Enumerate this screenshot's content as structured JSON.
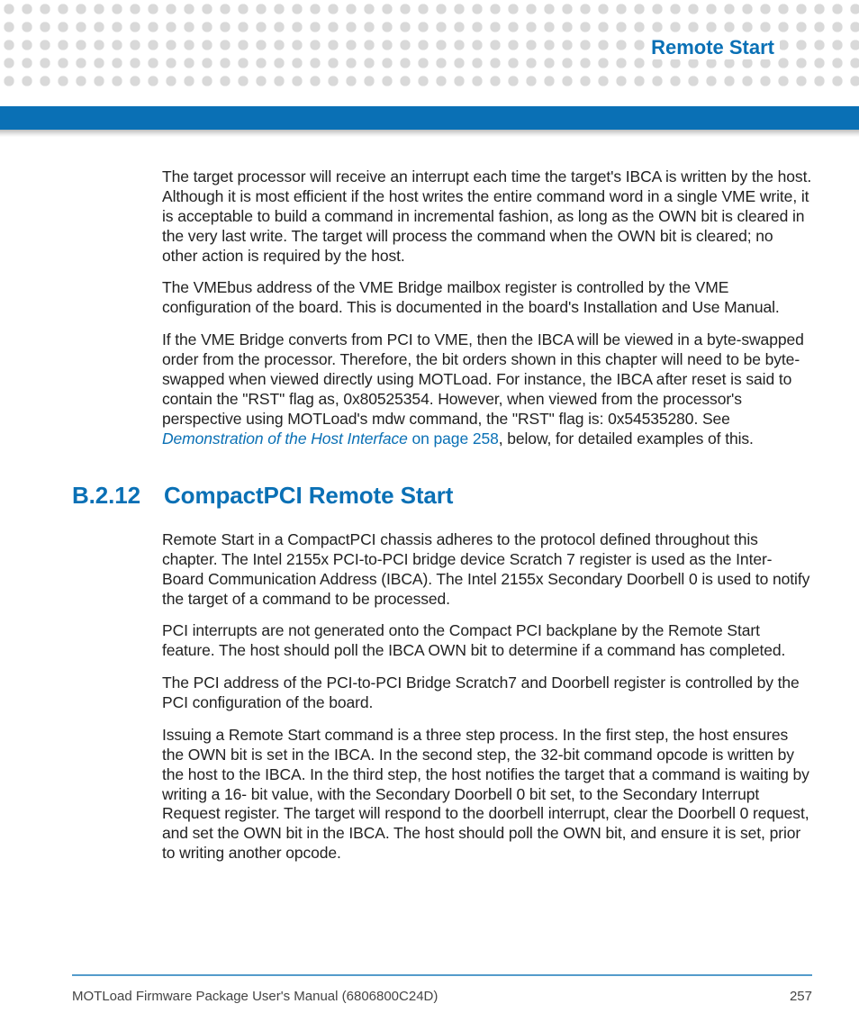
{
  "header": {
    "chapter_title": "Remote Start"
  },
  "body": {
    "p1": "The target processor will receive an interrupt each time the target's IBCA is written by the host. Although it is most efficient if the host writes the entire command word in a single VME write, it is acceptable to build a command in incremental fashion, as long as the OWN bit is cleared in the very last write. The target will process the command when the OWN bit is cleared; no other action is required by the host.",
    "p2": "The VMEbus address of the VME Bridge mailbox register is controlled by the VME configuration of the board. This is documented in the board's Installation and Use Manual.",
    "p3a": "If the VME Bridge converts from PCI to VME, then the IBCA will be viewed in a byte-swapped order from the processor. Therefore, the bit orders shown in this chapter will need to be byte-swapped when viewed directly using MOTLoad. For instance, the IBCA after reset is said to contain the \"RST\" flag as, 0x80525354. However, when viewed from the processor's perspective using MOTLoad's mdw command, the \"RST\" flag is: 0x54535280. See ",
    "p3_link_italic": "Demonstration of the Host Interface",
    "p3_link_rest": " on page 258",
    "p3b": ", below, for detailed examples of this.",
    "section_num": "B.2.12",
    "section_title": "CompactPCI Remote Start",
    "p4": "Remote Start in a CompactPCI chassis adheres to the protocol defined throughout this chapter. The Intel 2155x PCI-to-PCI bridge device Scratch 7 register is used as the Inter-Board Communication Address (IBCA). The Intel 2155x Secondary Doorbell 0 is used to notify the target of a command to be processed.",
    "p5": "PCI interrupts are not generated onto the Compact PCI backplane by the Remote Start feature. The host should poll the IBCA OWN bit to determine if a command has completed.",
    "p6": "The PCI address of the PCI-to-PCI Bridge Scratch7 and Doorbell register is controlled by the PCI configuration of the board.",
    "p7": "Issuing a Remote Start command is a three step process. In the first step, the host ensures the OWN bit is set in the IBCA. In the second step, the 32-bit command opcode is written by the host to the IBCA. In the third step, the host notifies the target that a command is waiting by writing a 16- bit value, with the Secondary Doorbell 0 bit set, to the Secondary Interrupt Request register. The target will respond to the doorbell interrupt, clear the Doorbell 0 request, and set the OWN bit in the IBCA. The host should poll the OWN bit, and ensure it is set, prior to writing another opcode."
  },
  "footer": {
    "manual": "MOTLoad Firmware Package User's Manual (6806800C24D)",
    "page": "257"
  }
}
